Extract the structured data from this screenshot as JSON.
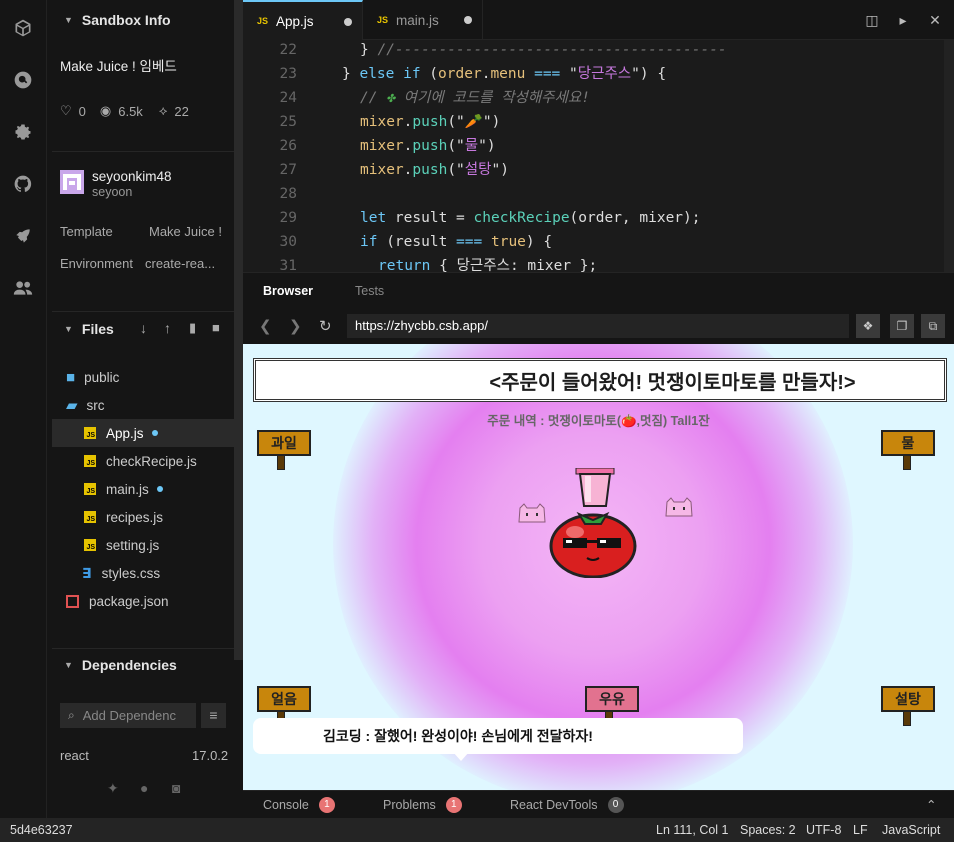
{
  "sidebar": {
    "sandbox_info_title": "Sandbox Info",
    "sandbox_name": "Make Juice ! 임베드",
    "likes": "0",
    "views": "6.5k",
    "forks": "22",
    "author": "seyoonkim48",
    "author_sub": "seyoon",
    "template_label": "Template",
    "template_value": "Make Juice !",
    "environment_label": "Environment",
    "environment_value": "create-rea...",
    "files_title": "Files",
    "files": [
      {
        "name": "public",
        "type": "folder"
      },
      {
        "name": "src",
        "type": "folder-open"
      },
      {
        "name": "App.js",
        "type": "js",
        "modified": true
      },
      {
        "name": "checkRecipe.js",
        "type": "js"
      },
      {
        "name": "main.js",
        "type": "js",
        "modified": true
      },
      {
        "name": "recipes.js",
        "type": "js"
      },
      {
        "name": "setting.js",
        "type": "js"
      },
      {
        "name": "styles.css",
        "type": "css"
      },
      {
        "name": "package.json",
        "type": "json"
      }
    ],
    "dependencies_title": "Dependencies",
    "add_dependency_placeholder": "Add Dependenc",
    "dependency_name": "react",
    "dependency_version": "17.0.2"
  },
  "editor": {
    "tabs": [
      {
        "label": "App.js",
        "active": true,
        "badge": "JS"
      },
      {
        "label": "main.js",
        "active": false,
        "badge": "JS"
      }
    ],
    "lines": [
      {
        "num": "22",
        "text": "} //-------------------------------------"
      },
      {
        "num": "23",
        "text": "} else if (order.menu === \"당근주스\") {"
      },
      {
        "num": "24",
        "text": "// 🍀 여기에 코드를 작성해주세요!"
      },
      {
        "num": "25",
        "text": "mixer.push(\"🥕\")"
      },
      {
        "num": "26",
        "text": "mixer.push(\"물\")"
      },
      {
        "num": "27",
        "text": "mixer.push(\"설탕\")"
      },
      {
        "num": "28",
        "text": ""
      },
      {
        "num": "29",
        "text": "let result = checkRecipe(order, mixer);"
      },
      {
        "num": "30",
        "text": "if (result === true) {"
      },
      {
        "num": "31",
        "text": "return { 당근주스: mixer };"
      }
    ]
  },
  "browser": {
    "tab_browser": "Browser",
    "tab_tests": "Tests",
    "url": "https://zhycbb.csb.app/",
    "title": "<주문이 들어왔어! 멋쟁이토마토를 만들자!>",
    "order": "주문 내역 : 멋쟁이토마토(🍅,멋짐) Tall1잔",
    "signs": [
      "과일",
      "물",
      "얼음",
      "우유",
      "설탕"
    ],
    "speech": "김코딩 : 잘했어! 완성이야! 손님에게 전달하자!"
  },
  "console": {
    "console_label": "Console",
    "console_count": "1",
    "problems_label": "Problems",
    "problems_count": "1",
    "devtools_label": "React DevTools",
    "devtools_count": "0"
  },
  "status": {
    "commit": "5d4e63237",
    "position": "Ln 111, Col 1",
    "spaces": "Spaces: 2",
    "encoding": "UTF-8",
    "eol": "LF",
    "language": "JavaScript"
  }
}
